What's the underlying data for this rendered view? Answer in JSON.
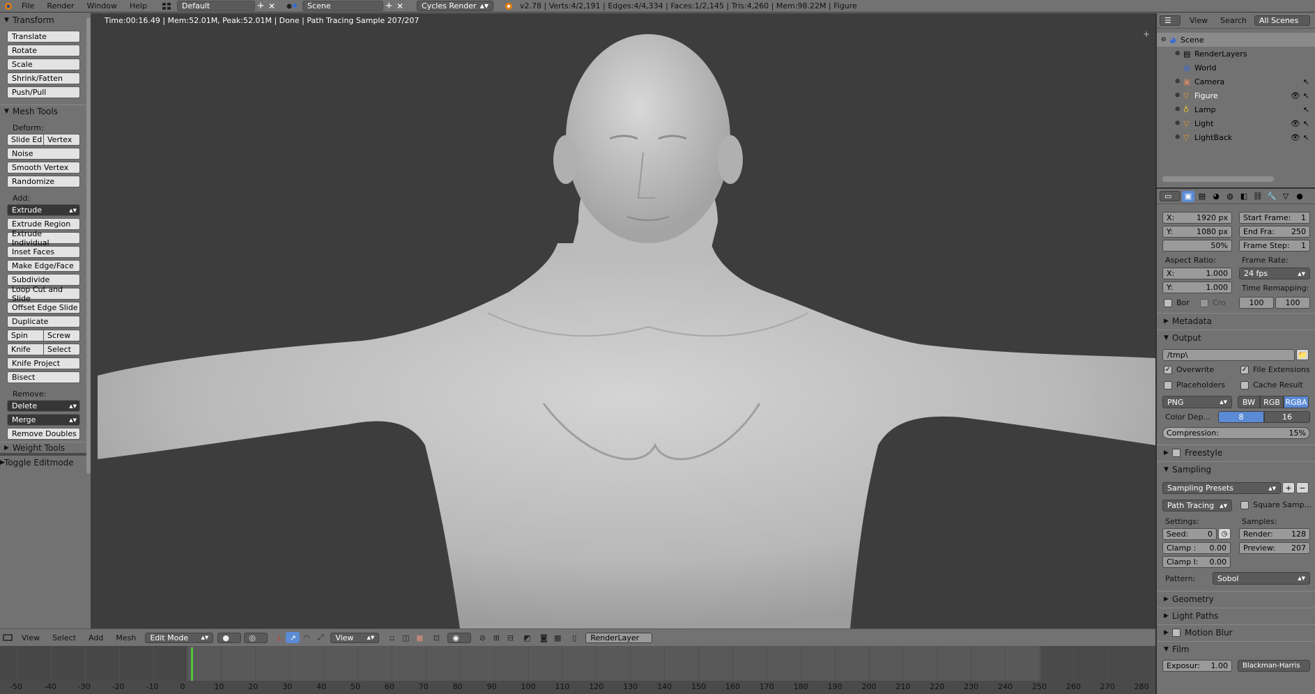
{
  "topbar": {
    "menus": [
      "File",
      "Render",
      "Window",
      "Help"
    ],
    "layout": "Default",
    "scene": "Scene",
    "engine": "Cycles Render",
    "stats": "v2.78 | Verts:4/2,191 | Edges:4/4,334 | Faces:1/2,145 | Tris:4,260 | Mem:98.22M | Figure"
  },
  "viewport": {
    "status": "Time:00:16.49 | Mem:52.01M, Peak:52.01M | Done | Path Tracing Sample 207/207"
  },
  "toolshelf": {
    "transform_title": "Transform",
    "translate": "Translate",
    "rotate": "Rotate",
    "scale": "Scale",
    "shrink": "Shrink/Fatten",
    "pushpull": "Push/Pull",
    "mesh_title": "Mesh Tools",
    "deform": "Deform:",
    "slide_edge": "Slide Ed",
    "vertex": "Vertex",
    "noise": "Noise",
    "smooth_vertex": "Smooth Vertex",
    "randomize": "Randomize",
    "add": "Add:",
    "extrude": "Extrude",
    "extrude_region": "Extrude Region",
    "extrude_individual": "Extrude Individual",
    "inset": "Inset Faces",
    "make_edge": "Make Edge/Face",
    "subdivide": "Subdivide",
    "loop_cut": "Loop Cut and Slide",
    "offset_edge": "Offset Edge Slide",
    "duplicate": "Duplicate",
    "spin": "Spin",
    "screw": "Screw",
    "knife": "Knife",
    "select": "Select",
    "knife_project": "Knife Project",
    "bisect": "Bisect",
    "remove": "Remove:",
    "delete": "Delete",
    "merge": "Merge",
    "remove_doubles": "Remove Doubles",
    "weight_tools": "Weight Tools",
    "toggle_editmode": "Toggle Editmode"
  },
  "vp_header": {
    "view": "View",
    "select": "Select",
    "add": "Add",
    "mesh": "Mesh",
    "mode": "Edit Mode",
    "pivot_view": "View",
    "render_layer": "RenderLayer"
  },
  "timeline": {
    "ticks": [
      "-50",
      "-40",
      "-30",
      "-20",
      "-10",
      "0",
      "10",
      "20",
      "30",
      "40",
      "50",
      "60",
      "70",
      "80",
      "90",
      "100",
      "110",
      "120",
      "130",
      "140",
      "150",
      "160",
      "170",
      "180",
      "190",
      "200",
      "210",
      "220",
      "230",
      "240",
      "250",
      "260",
      "270",
      "280"
    ]
  },
  "outliner": {
    "view": "View",
    "search": "Search",
    "scenes": "All Scenes",
    "items": [
      "Scene",
      "RenderLayers",
      "World",
      "Camera",
      "Figure",
      "Lamp",
      "Light",
      "LightBack"
    ]
  },
  "props": {
    "res_x": "X:",
    "res_x_val": "1920 px",
    "res_y": "Y:",
    "res_y_val": "1080 px",
    "res_pct": "50%",
    "start_frame": "Start Frame:",
    "start_val": "1",
    "end_frame": "End Fra:",
    "end_val": "250",
    "frame_step": "Frame Step:",
    "step_val": "1",
    "aspect": "Aspect Ratio:",
    "asp_x": "X:",
    "asp_x_val": "1.000",
    "asp_y": "Y:",
    "asp_y_val": "1.000",
    "frame_rate": "Frame Rate:",
    "fps": "24 fps",
    "time_remap": "Time Remapping:",
    "remap_a": "100",
    "remap_b": "100",
    "bor": "Bor",
    "cro": "Cro",
    "metadata": "Metadata",
    "output": "Output",
    "path": "/tmp\\",
    "overwrite": "Overwrite",
    "file_ext": "File Extensions",
    "placeholders": "Placeholders",
    "cache": "Cache Result",
    "format": "PNG",
    "bw": "BW",
    "rgb": "RGB",
    "rgba": "RGBA",
    "color_depth": "Color Dep...",
    "depth8": "8",
    "depth16": "16",
    "compression": "Compression:",
    "comp_val": "15%",
    "freestyle": "Freestyle",
    "sampling": "Sampling",
    "sampling_presets": "Sampling Presets",
    "path_tracing": "Path Tracing",
    "square": "Square Samp...",
    "settings": "Settings:",
    "samples": "Samples:",
    "seed": "Seed:",
    "seed_val": "0",
    "render": "Render:",
    "render_val": "128",
    "clamp_d": "Clamp :",
    "clamp_d_val": "0.00",
    "preview": "Preview:",
    "preview_val": "207",
    "clamp_i": "Clamp I:",
    "clamp_i_val": "0.00",
    "pattern": "Pattern:",
    "pattern_val": "Sobol",
    "geometry": "Geometry",
    "light_paths": "Light Paths",
    "motion_blur": "Motion Blur",
    "film": "Film",
    "exposure": "Exposur:",
    "exposure_val": "1.00",
    "filter": "Blackman-Harris"
  }
}
